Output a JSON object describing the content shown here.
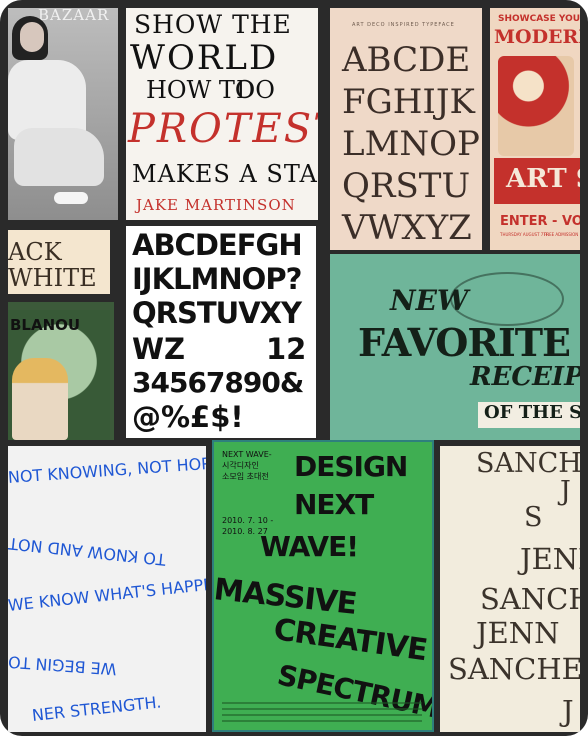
{
  "tiles": {
    "fashion": {
      "masthead": "BAZAAR"
    },
    "tall_poster": {
      "lines": [
        "SHOW THE",
        "WORLD",
        "HOW TO",
        "DO",
        "PROTEST",
        "MAKES A STAND"
      ],
      "credit": "JAKE MARTINSON"
    },
    "alphabet_peach": {
      "header": "ART DECO INSPIRED TYPEFACE",
      "rows": [
        "ABCDE",
        "FGHIJK",
        "LMNOP",
        "QRSTU",
        "VWXYZ"
      ]
    },
    "modern_poster": {
      "top": "SHOWCASE YOUR",
      "title": "MODERN POSTER",
      "mid": "ART SHOW",
      "bottom": "ENTER - VOTE",
      "small_left": "THURSDAY AUGUST 7TH",
      "small_right": "FREE ADMISSION"
    },
    "black_white": {
      "line1": "ACK",
      "line2": "WHITE"
    },
    "alphabet_white": {
      "rows": [
        "ABCDEFGH",
        "IJKLMNOP?",
        "QRSTUVXY",
        "WZ",
        "12",
        "34567890&",
        "@%£$!"
      ]
    },
    "art_nouveau": {
      "text": "BLANOU"
    },
    "green_cook": {
      "new": "NEW",
      "title": "FAVORITE COOK",
      "sub": "RECEIPT",
      "bottom": "OF THE SH"
    },
    "knowing": {
      "lines": [
        "NOT KNOWING, NOT HOPING",
        "TO KNOW AND NOT",
        "WE KNOW WHAT'S HAPPENING",
        "WE BEGIN TO",
        "NER STRENGTH."
      ]
    },
    "next_wave": {
      "kor_title": "NEXT WAVE-\n시각디자인\n소모임 초대전",
      "dates": "2010. 7. 10 -\n2010. 8. 27",
      "big": [
        "DESIGN",
        "NEXT",
        "WAVE!",
        "MASSIVE",
        "CREATIVE",
        "SPECTRUM:"
      ]
    },
    "jenn": {
      "lines": [
        "SANCHEZ",
        "J",
        "S",
        "JENN",
        "SANCH",
        "JENN",
        "SANCHEZ",
        "J"
      ]
    }
  },
  "colors": {
    "frame": "#2a2a2a",
    "cream": "#f4e6cf",
    "peach": "#efd9c8",
    "green": "#3fae52",
    "teal_paper": "#6fb59a",
    "blue_text": "#1f57d4",
    "red": "#c4312c"
  }
}
